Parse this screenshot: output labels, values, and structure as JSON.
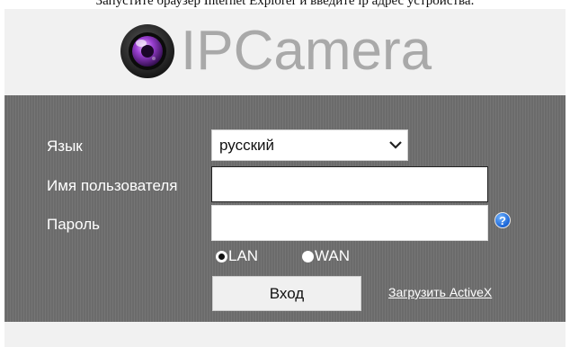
{
  "caption": "Запустите браузер Internet Explorer и введите ip адрес устройства.",
  "logo": {
    "text": "IPCamera"
  },
  "form": {
    "language_label": "Язык",
    "language_value": "русский",
    "username_label": "Имя пользователя",
    "username_value": "",
    "password_label": "Пароль",
    "password_value": "",
    "help_glyph": "?",
    "lan_label": "LAN",
    "wan_label": "WAN",
    "selected_network": "LAN",
    "login_button": "Вход",
    "activex_link": "Загрузить ActiveX"
  },
  "colors": {
    "panel": "#6e6e6e",
    "header": "#f1f1f1",
    "logo_text": "#a9a9a9",
    "help_icon": "#1a64d6"
  },
  "icons": [
    "camera-lens-icon",
    "chevron-down-icon",
    "help-icon"
  ]
}
